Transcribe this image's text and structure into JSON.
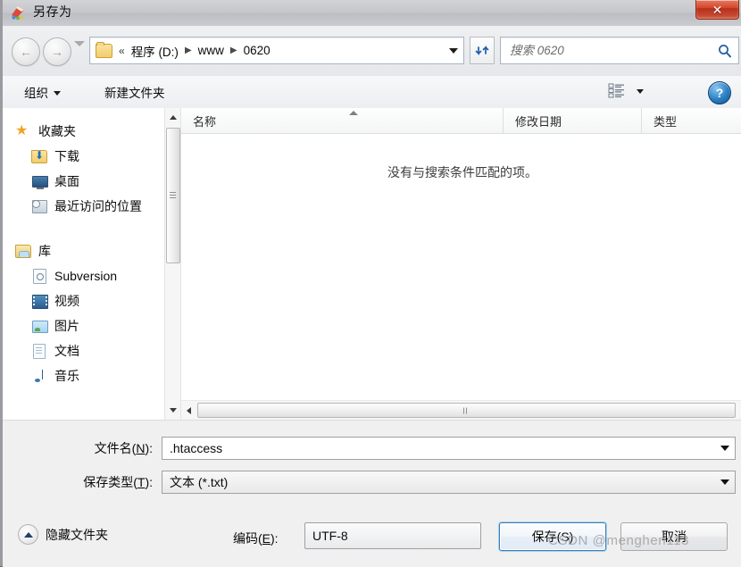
{
  "window": {
    "title": "另存为",
    "title_icon": "notepad-icon",
    "close_label": "✕"
  },
  "nav": {
    "back_icon": "back-arrow-icon",
    "forward_icon": "forward-arrow-icon",
    "history_icon": "chevron-down-icon",
    "address": {
      "folder_icon": "folder-icon",
      "overflow": "«",
      "crumbs": [
        "程序 (D:)",
        "www",
        "0620"
      ],
      "separator": "▶",
      "dropdown_icon": "chevron-down-icon"
    },
    "refresh_icon": "refresh-icon",
    "search": {
      "placeholder": "搜索 0620",
      "value": "",
      "icon": "search-icon"
    }
  },
  "toolbar": {
    "organize_label": "组织",
    "new_folder_label": "新建文件夹",
    "view_icon": "list-view-icon",
    "view_caret_icon": "chevron-down-icon",
    "help_label": "?",
    "help_icon": "help-icon"
  },
  "sidebar": {
    "groups": [
      {
        "head": {
          "label": "收藏夹",
          "icon": "star-icon"
        },
        "items": [
          {
            "label": "下载",
            "icon": "downloads-folder-icon"
          },
          {
            "label": "桌面",
            "icon": "desktop-icon"
          },
          {
            "label": "最近访问的位置",
            "icon": "recent-places-icon"
          }
        ]
      },
      {
        "head": {
          "label": "库",
          "icon": "libraries-icon"
        },
        "items": [
          {
            "label": "Subversion",
            "icon": "subversion-icon"
          },
          {
            "label": "视频",
            "icon": "video-icon"
          },
          {
            "label": "图片",
            "icon": "pictures-icon"
          },
          {
            "label": "文档",
            "icon": "documents-icon"
          },
          {
            "label": "音乐",
            "icon": "music-icon"
          }
        ]
      }
    ],
    "scrollbar": {
      "up_icon": "scroll-up-icon",
      "down_icon": "scroll-down-icon"
    }
  },
  "filelist": {
    "columns": [
      {
        "label": "名称",
        "sorted": "asc"
      },
      {
        "label": "修改日期"
      },
      {
        "label": "类型"
      }
    ],
    "rows": [],
    "empty_message": "没有与搜索条件匹配的项。",
    "hscroll": {
      "left_icon": "scroll-left-icon"
    }
  },
  "form": {
    "filename": {
      "label_prefix": "文件名(",
      "label_key": "N",
      "label_suffix": "):",
      "value": ".htaccess",
      "dropdown_icon": "chevron-down-icon"
    },
    "filetype": {
      "label_prefix": "保存类型(",
      "label_key": "T",
      "label_suffix": "):",
      "value": "文本 (*.txt)",
      "dropdown_icon": "chevron-down-icon"
    }
  },
  "bottom": {
    "hide_folders_label": "隐藏文件夹",
    "hide_folders_icon": "collapse-up-icon",
    "encoding": {
      "label_prefix": "编码(",
      "label_key": "E",
      "label_suffix": "):",
      "value": "UTF-8",
      "dropdown_icon": "chevron-down-icon"
    },
    "save_label": "保存(S)",
    "cancel_label": "取消"
  },
  "watermark": "CSDN @menghen113",
  "colors": {
    "dialog_bg": "#f0f0f0",
    "accent_blue": "#3c7fb1",
    "close_red": "#d2462d",
    "desktop": "#6b6a70"
  }
}
